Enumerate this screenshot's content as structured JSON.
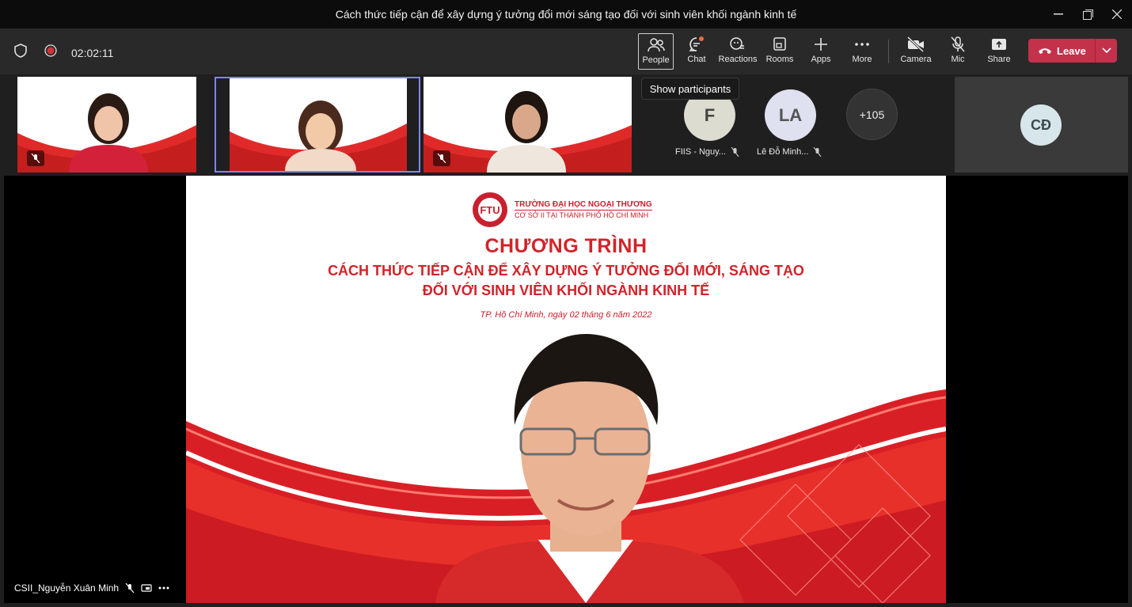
{
  "window": {
    "title": "Cách thức tiếp cận để xây dựng ý tưởng đổi mới sáng tạo đối với sinh viên khối ngành kinh tế"
  },
  "toolbar": {
    "timer": "02:02:11",
    "people_label": "People",
    "chat_label": "Chat",
    "reactions_label": "Reactions",
    "rooms_label": "Rooms",
    "apps_label": "Apps",
    "more_label": "More",
    "camera_label": "Camera",
    "mic_label": "Mic",
    "share_label": "Share",
    "leave_label": "Leave"
  },
  "tooltip": {
    "text": "Show participants"
  },
  "participants": {
    "avatars": [
      {
        "initials": "F",
        "name": "FIIS - Nguy..."
      },
      {
        "initials": "LA",
        "name": "Lê Đỗ Minh..."
      }
    ],
    "overflow": "+105",
    "pinned_initials": "CĐ"
  },
  "slide": {
    "school": "TRƯỜNG ĐẠI HỌC NGOẠI THƯƠNG",
    "campus": "CƠ SỞ II TẠI THÀNH PHỐ HỒ CHÍ MINH",
    "heading": "CHƯƠNG TRÌNH",
    "subtitle_line1": "CÁCH THỨC TIẾP CẬN ĐỂ XÂY DỰNG Ý TƯỞNG ĐỔI MỚI, SÁNG TẠO",
    "subtitle_line2": "ĐỐI VỚI SINH VIÊN KHỐI NGÀNH KINH TẾ",
    "date": "TP. Hồ Chí Minh, ngày 02 tháng 6 năm 2022"
  },
  "speaker": {
    "name": "CSII_Nguyễn Xuân Minh"
  },
  "colors": {
    "leave": "#c4314b",
    "brand_red": "#d2232a",
    "selected_border": "#7f85f5"
  }
}
